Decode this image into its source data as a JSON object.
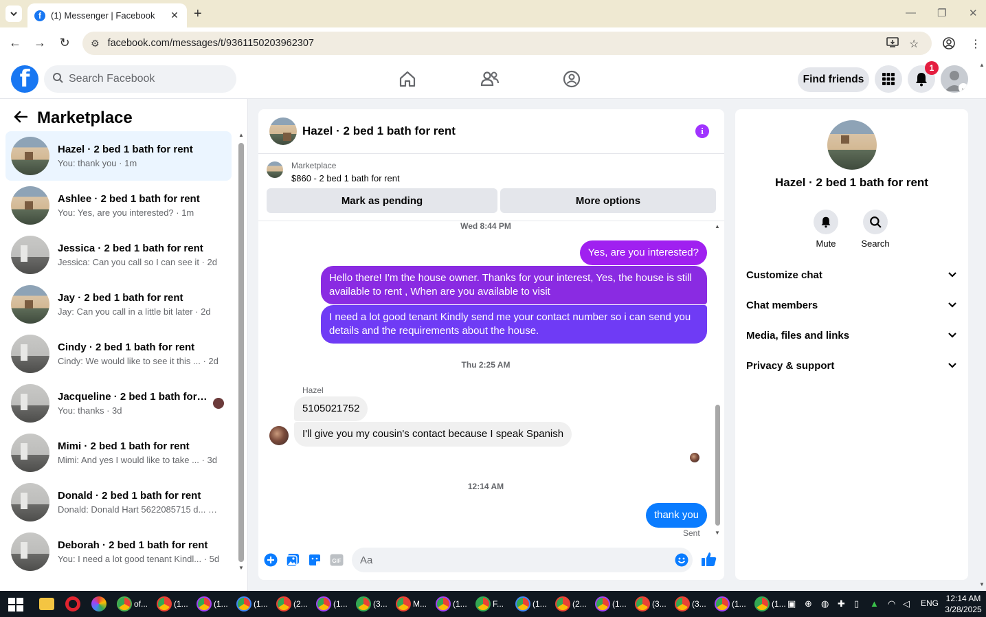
{
  "browser": {
    "tab_title": "(1) Messenger | Facebook",
    "url": "facebook.com/messages/t/9361150203962307"
  },
  "fb": {
    "logo": "f",
    "search_placeholder": "Search Facebook",
    "find_friends": "Find friends",
    "notification_count": "1"
  },
  "sidebar": {
    "title": "Marketplace",
    "conversations": [
      {
        "name": "Hazel · 2 bed 1 bath for rent",
        "preview": "You: thank you · 1m",
        "thumb": "house"
      },
      {
        "name": "Ashlee · 2 bed 1 bath for rent",
        "preview": "You: Yes, are you interested? · 1m",
        "thumb": "house"
      },
      {
        "name": "Jessica · 2 bed 1 bath for rent",
        "preview": "Jessica: Can you call so I can see it · 2d",
        "thumb": "room"
      },
      {
        "name": "Jay · 2 bed 1 bath for rent",
        "preview": "Jay: Can you call in a little bit later · 2d",
        "thumb": "house"
      },
      {
        "name": "Cindy · 2 bed 1 bath for rent",
        "preview": "Cindy: We would like to see it this ... · 2d",
        "thumb": "room"
      },
      {
        "name": "Jacqueline · 2 bed 1 bath for r...",
        "preview": "You: thanks · 3d",
        "thumb": "room"
      },
      {
        "name": "Mimi · 2 bed 1 bath for rent",
        "preview": "Mimi: And yes I would like to take ... · 3d",
        "thumb": "room"
      },
      {
        "name": "Donald · 2 bed 1 bath for rent",
        "preview": "Donald: Donald Hart 5622085715 d... · 5d",
        "thumb": "room"
      },
      {
        "name": "Deborah · 2 bed 1 bath for rent",
        "preview": "You: I need a lot good tenant Kindl... · 5d",
        "thumb": "room"
      }
    ]
  },
  "chat": {
    "title": "Hazel · 2 bed 1 bath for rent",
    "marketplace_label": "Marketplace",
    "listing": "$860 - 2 bed 1 bath for rent",
    "mark_pending": "Mark as pending",
    "more_options": "More options",
    "time1": "Wed 8:44 PM",
    "msg_out_1": "Yes, are you interested?",
    "msg_out_2": "Hello there! I'm the house owner. Thanks for your interest, Yes, the house is still available to rent , When are you available to visit",
    "msg_out_3": "I need a lot good tenant Kindly send me your contact number so i can send you details and the requirements about the house.",
    "time2": "Thu 2:25 AM",
    "sender_name": "Hazel",
    "msg_in_1": "5105021752",
    "msg_in_2": "I'll give you my cousin's contact because I speak Spanish",
    "time3": "12:14 AM",
    "msg_out_4": "thank you",
    "sent_status": "Sent",
    "composer_placeholder": "Aa"
  },
  "info_panel": {
    "title": "Hazel · 2 bed 1 bath for rent",
    "mute": "Mute",
    "search": "Search",
    "sections": [
      "Customize chat",
      "Chat members",
      "Media, files and links",
      "Privacy & support"
    ]
  },
  "taskbar": {
    "apps": [
      "of...",
      "(1...",
      "(1...",
      "(1...",
      "(2...",
      "(1...",
      "(3...",
      "M...",
      "(1...",
      "F...",
      "(1...",
      "(2...",
      "(1...",
      "(3...",
      "(3...",
      "(1...",
      "(1..."
    ],
    "language": "ENG",
    "time": "12:14 AM",
    "date": "3/28/2025"
  },
  "colors": {
    "fb_blue": "#1877f2",
    "messenger_purple": "#a033ff",
    "bubble_top": "#a020f0",
    "bubble_mid": "#8a2be2",
    "bubble_bottom": "#6f3bf5",
    "bubble_blue": "#0a7cff"
  }
}
